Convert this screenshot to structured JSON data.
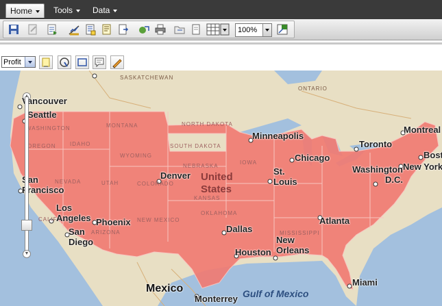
{
  "menubar": {
    "tabs": [
      {
        "label": "Home",
        "active": true
      },
      {
        "label": "Tools",
        "active": false
      },
      {
        "label": "Data",
        "active": false
      }
    ]
  },
  "toolbar": {
    "zoom_value": "100%",
    "icons": [
      "save-icon",
      "edit-document-icon",
      "export-document-icon",
      "chart-settings-icon",
      "page-setup-icon",
      "notes-icon",
      "send-icon",
      "share-icon",
      "print-icon",
      "folder-icon",
      "page-icon",
      "grid-layout-icon",
      "fullscreen-icon"
    ]
  },
  "map_tools": {
    "measure_select": "Profit",
    "icons": [
      "highlighter-icon",
      "lasso-select-icon",
      "rectangle-select-icon",
      "comment-icon",
      "edit-pencil-icon"
    ]
  },
  "map": {
    "highlight_color": "#f07b72",
    "province_labels": [
      "SASKATCHEWAN",
      "ONTARIO"
    ],
    "state_labels": [
      "WASHINGTON",
      "MONTANA",
      "NORTH DAKOTA",
      "SOUTH DAKOTA",
      "OREGON",
      "IDAHO",
      "WYOMING",
      "NEBRASKA",
      "IOWA",
      "NEVADA",
      "UTAH",
      "COLORADO",
      "KANSAS",
      "ARIZONA",
      "NEW MEXICO",
      "OKLAHOMA",
      "CALIFORNIA",
      "MISSISSIPPI"
    ],
    "cities": [
      "Vancouver",
      "Seattle",
      "San Francisco",
      "Los Angeles",
      "San Diego",
      "Phoenix",
      "Denver",
      "United States",
      "Dallas",
      "Houston",
      "New Orleans",
      "Atlanta",
      "Minneapolis",
      "Chicago",
      "St. Louis",
      "Toronto",
      "Montreal",
      "Washington D.C.",
      "New York",
      "Boston",
      "Miami",
      "Mexico",
      "Monterrey"
    ],
    "water_labels": [
      "Gulf of Mexico"
    ]
  }
}
